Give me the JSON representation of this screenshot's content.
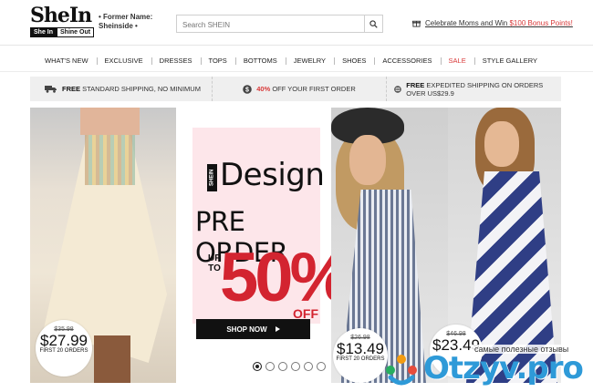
{
  "header": {
    "logo": {
      "word": "SheIn",
      "tag_dark": "She In",
      "tag_light": "Shine Out"
    },
    "former_name": {
      "line1": "• Former Name:",
      "line2": "Sheinside •"
    },
    "search": {
      "placeholder": "Search SHEIN"
    },
    "promo": {
      "prefix": "Celebrate Moms and Win ",
      "amount": "$100 Bonus Points!"
    }
  },
  "nav": {
    "items": [
      "WHAT'S NEW",
      "EXCLUSIVE",
      "DRESSES",
      "TOPS",
      "BOTTOMS",
      "JEWELRY",
      "SHOES",
      "ACCESSORIES",
      "SALE",
      "STYLE GALLERY"
    ]
  },
  "shipping": {
    "standard": {
      "bold": "FREE",
      "text": " STANDARD SHIPPING, NO MINIMUM"
    },
    "discount": {
      "pct": "40%",
      "text": " OFF YOUR FIRST ORDER"
    },
    "expedited": {
      "bold": "FREE",
      "text": " EXPEDITED SHIPPING ON ORDERS OVER US$29.9"
    }
  },
  "banner": {
    "badge": "SHEIN",
    "design": "Design",
    "preorder": "PRE ORDER",
    "upto": "UP TO",
    "pct": "50%",
    "off": "OFF",
    "shop_button": "SHOP NOW",
    "tags": [
      {
        "old": "$35.98",
        "new": "$27.99",
        "note": "FIRST 20 ORDERS"
      },
      {
        "old": "$26.98",
        "new": "$13.49",
        "note": "FIRST 20 ORDERS"
      },
      {
        "old": "$46.98",
        "new": "$23.49",
        "note": ""
      }
    ],
    "carousel": {
      "slides": 6,
      "active": 1
    }
  },
  "watermark": {
    "caption": "самые полезные отзывы",
    "text": "Otzyv.pro"
  },
  "colors": {
    "accent": "#d93a3a",
    "promo_red": "#d32430",
    "watermark_blue": "#2e9ad8"
  }
}
